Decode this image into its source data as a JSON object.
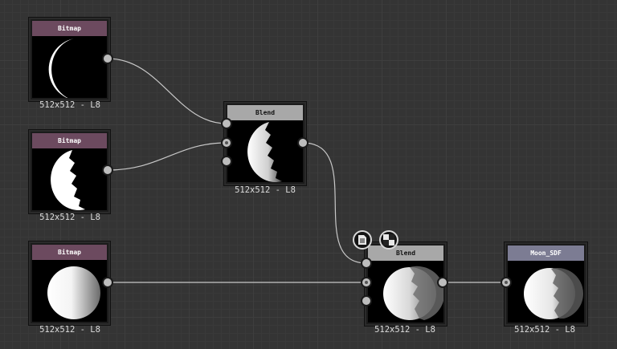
{
  "nodes": {
    "bitmap1": {
      "title": "Bitmap",
      "caption": "512x512 - L8"
    },
    "bitmap2": {
      "title": "Bitmap",
      "caption": "512x512 - L8"
    },
    "bitmap3": {
      "title": "Bitmap",
      "caption": "512x512 - L8"
    },
    "blend1": {
      "title": "Blend",
      "caption": "512x512 - L8"
    },
    "blend2": {
      "title": "Blend",
      "caption": "512x512 - L8"
    },
    "moon_sdf": {
      "title": "Moon_SDF",
      "caption": "512x512 - L8"
    }
  },
  "colors": {
    "bitmap_header": "#6c4a5f",
    "blend_header": "#a8a8a8",
    "output_header": "#7c7c93",
    "wire": "#c8c8c8",
    "port": "#bdbdbd"
  },
  "toolbar_icons": [
    "document-icon",
    "checker-icon"
  ]
}
